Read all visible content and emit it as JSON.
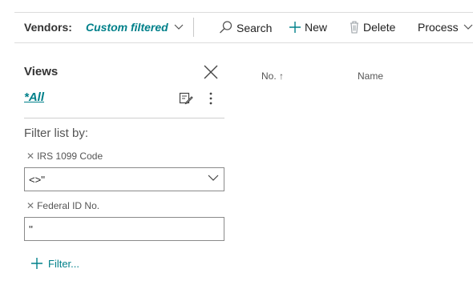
{
  "toolbar": {
    "vendors_label": "Vendors:",
    "view_filter": "Custom filtered",
    "search_label": "Search",
    "new_label": "New",
    "delete_label": "Delete",
    "process_label": "Process"
  },
  "filter_pane": {
    "views_title": "Views",
    "all_view": "*All",
    "filter_list_by": "Filter list by:",
    "filters": [
      {
        "label": "IRS 1099 Code",
        "value": "<>''"
      },
      {
        "label": "Federal ID No.",
        "value": "''"
      }
    ],
    "add_filter_label": "Filter..."
  },
  "list": {
    "columns": [
      {
        "label": "No. ↑"
      },
      {
        "label": "Name"
      }
    ]
  },
  "colors": {
    "accent": "#00808a",
    "border": "#8a8a8a",
    "separator": "#dcdcdc"
  }
}
